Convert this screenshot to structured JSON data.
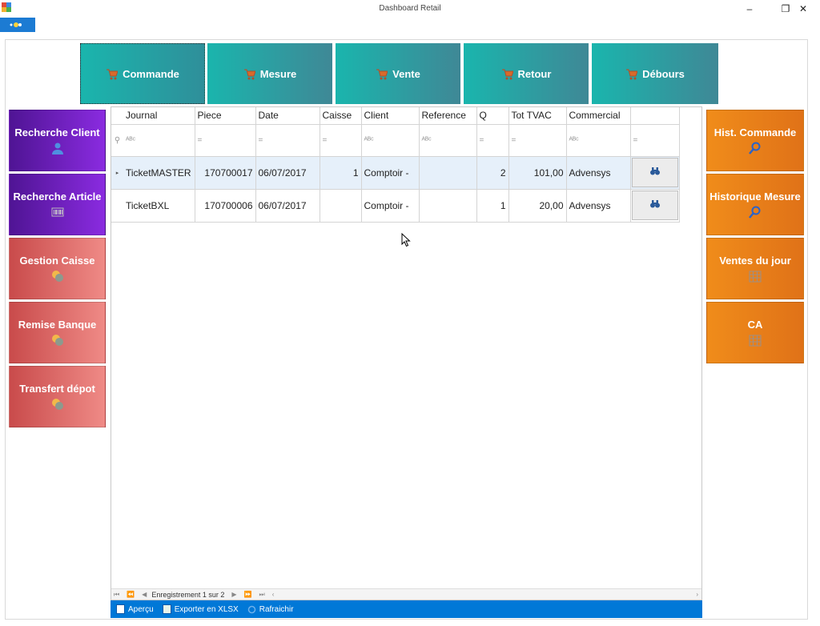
{
  "window": {
    "title": "Dashboard Retail",
    "minimize": "–",
    "maximize": "❐",
    "close": "✕"
  },
  "top_tiles": [
    {
      "label": "Commande",
      "icon": "cart-icon"
    },
    {
      "label": "Mesure",
      "icon": "cart-icon"
    },
    {
      "label": "Vente",
      "icon": "cart-icon"
    },
    {
      "label": "Retour",
      "icon": "cart-icon"
    },
    {
      "label": "Débours",
      "icon": "cart-icon"
    }
  ],
  "left_tiles": [
    {
      "label": "Recherche Client",
      "icon": "user-icon"
    },
    {
      "label": "Recherche Article",
      "icon": "barcode-icon"
    },
    {
      "label": "Gestion Caisse",
      "icon": "coins-icon"
    },
    {
      "label": "Remise Banque",
      "icon": "coins-icon"
    },
    {
      "label": "Transfert dépot",
      "icon": "coins-icon"
    }
  ],
  "right_tiles": [
    {
      "label": "Hist. Commande",
      "icon": "search-icon"
    },
    {
      "label": "Historique Mesure",
      "icon": "search-icon"
    },
    {
      "label": "Ventes du jour",
      "icon": "calendar-icon"
    },
    {
      "label": "CA",
      "icon": "calendar-icon"
    }
  ],
  "grid": {
    "columns": [
      "Journal",
      "Piece",
      "Date",
      "Caisse",
      "Client",
      "Reference",
      "Q",
      "Tot TVAC",
      "Commercial",
      ""
    ],
    "filter_row": [
      "ᴬᴮᶜ",
      "=",
      "=",
      "=",
      "ᴬᴮᶜ",
      "ᴬᴮᶜ",
      "=",
      "=",
      "ᴬᴮᶜ",
      "="
    ],
    "rows": [
      {
        "journal": "TicketMASTER",
        "piece": "170700017",
        "date": "06/07/2017",
        "caisse": "1",
        "client": "Comptoir -",
        "reference": "",
        "q": "2",
        "tot_tvac": "101,00",
        "commercial": "Advensys"
      },
      {
        "journal": "TicketBXL",
        "piece": "170700006",
        "date": "06/07/2017",
        "caisse": "",
        "client": "Comptoir -",
        "reference": "",
        "q": "1",
        "tot_tvac": "20,00",
        "commercial": "Advensys"
      }
    ],
    "navigator": {
      "record_text": "Enregistrement 1 sur 2"
    }
  },
  "bottombar": {
    "apercu": "Aperçu",
    "export": "Exporter en XLSX",
    "refresh": "Rafraichir"
  },
  "colors": {
    "top_tile": "#25a9a7",
    "left_purple": "#6a1bb8",
    "left_red": "#d9645f",
    "right_orange": "#ef7f1a",
    "bottombar": "#0078d7"
  }
}
